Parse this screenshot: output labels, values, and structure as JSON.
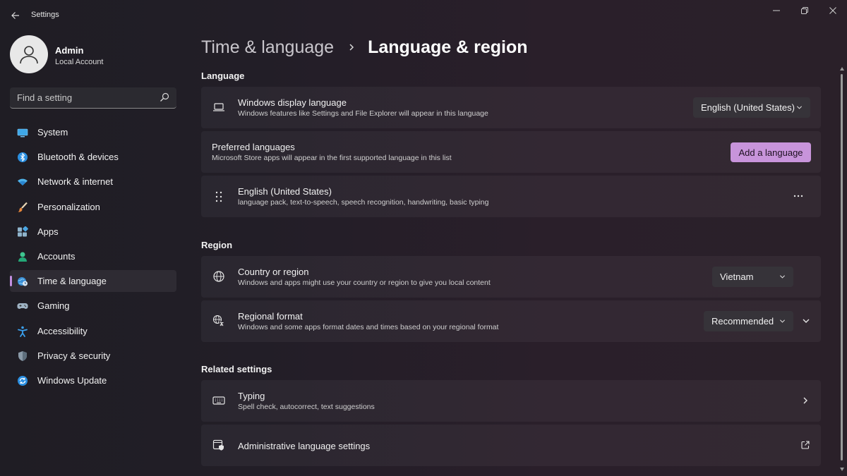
{
  "window": {
    "title": "Settings",
    "controls": [
      "minimize",
      "restore",
      "close"
    ]
  },
  "profile": {
    "name": "Admin",
    "account_type": "Local Account"
  },
  "search": {
    "placeholder": "Find a setting"
  },
  "sidebar": {
    "items": [
      {
        "label": "System",
        "icon": "system-icon",
        "active": false
      },
      {
        "label": "Bluetooth & devices",
        "icon": "bluetooth-icon",
        "active": false
      },
      {
        "label": "Network & internet",
        "icon": "wifi-icon",
        "active": false
      },
      {
        "label": "Personalization",
        "icon": "brush-icon",
        "active": false
      },
      {
        "label": "Apps",
        "icon": "apps-icon",
        "active": false
      },
      {
        "label": "Accounts",
        "icon": "accounts-icon",
        "active": false
      },
      {
        "label": "Time & language",
        "icon": "globe-clock-icon",
        "active": true
      },
      {
        "label": "Gaming",
        "icon": "gamepad-icon",
        "active": false
      },
      {
        "label": "Accessibility",
        "icon": "accessibility-icon",
        "active": false
      },
      {
        "label": "Privacy & security",
        "icon": "shield-icon",
        "active": false
      },
      {
        "label": "Windows Update",
        "icon": "update-icon",
        "active": false
      }
    ]
  },
  "breadcrumb": {
    "parent": "Time & language",
    "current": "Language & region"
  },
  "language": {
    "section_title": "Language",
    "display_language": {
      "title": "Windows display language",
      "description": "Windows features like Settings and File Explorer will appear in this language",
      "value": "English (United States)"
    },
    "preferred": {
      "title": "Preferred languages",
      "description": "Microsoft Store apps will appear in the first supported language in this list",
      "button": "Add a language"
    },
    "installed": [
      {
        "name": "English (United States)",
        "features": "language pack, text-to-speech, speech recognition, handwriting, basic typing"
      }
    ]
  },
  "region": {
    "section_title": "Region",
    "country": {
      "title": "Country or region",
      "description": "Windows and apps might use your country or region to give you local content",
      "value": "Vietnam"
    },
    "format": {
      "title": "Regional format",
      "description": "Windows and some apps format dates and times based on your regional format",
      "value": "Recommended"
    }
  },
  "related": {
    "section_title": "Related settings",
    "typing": {
      "title": "Typing",
      "description": "Spell check, autocorrect, text suggestions"
    },
    "admin": {
      "title": "Administrative language settings"
    }
  },
  "colors": {
    "accent": "#c894db",
    "active_indicator": "#c38fe0",
    "background": "#221e27",
    "card": "#2c2830"
  }
}
